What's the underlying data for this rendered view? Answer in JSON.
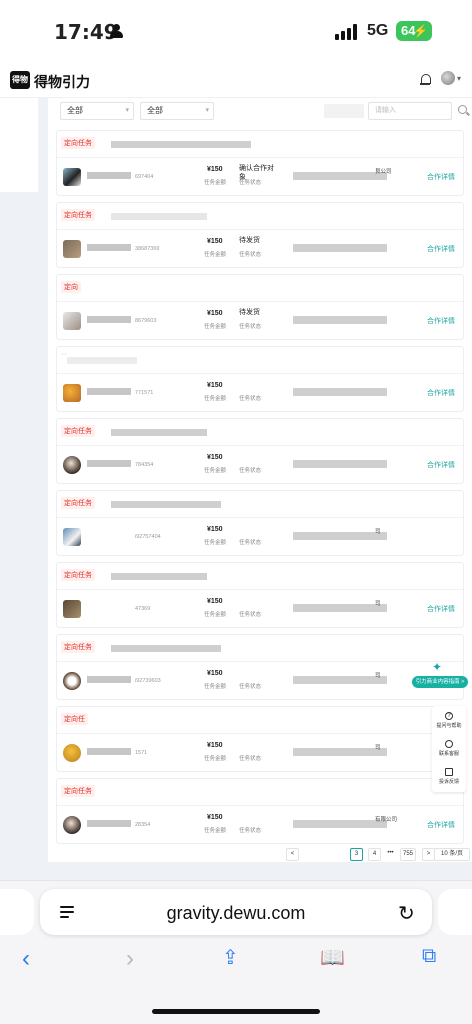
{
  "status_bar": {
    "time": "17:49",
    "network": "5G",
    "battery": "64"
  },
  "header": {
    "logo_mark": "得物",
    "logo_text": "得物引力"
  },
  "filters": {
    "filter1": "全部",
    "filter2": "全部",
    "search_placeholder": "请输入"
  },
  "cards": [
    {
      "tag": "定向任务",
      "code": "697404",
      "amount": "¥150",
      "amount_label": "任务金额",
      "status": "确认合作对象",
      "status_label": "任务状态",
      "company": "艮公司",
      "link": "合作详情"
    },
    {
      "tag": "定向任务",
      "code": "38687369",
      "amount": "¥150",
      "amount_label": "任务金额",
      "status": "待发货",
      "status_label": "任务状态",
      "company": "",
      "link": "合作详情"
    },
    {
      "tag": "定向",
      "code": "8679603",
      "amount": "¥150",
      "amount_label": "任务金额",
      "status": "待发货",
      "status_label": "任务状态",
      "company": "",
      "link": "合作详情"
    },
    {
      "tag": "",
      "code": "771571",
      "amount": "¥150",
      "amount_label": "任务金额",
      "status": "",
      "status_label": "任务状态",
      "company": "",
      "link": "合作详情"
    },
    {
      "tag": "定向任务",
      "code": "784354",
      "amount": "¥150",
      "amount_label": "任务金额",
      "status": "",
      "status_label": "任务状态",
      "company": "",
      "link": "合作详情"
    },
    {
      "tag": "定向任务",
      "code": "i92757404",
      "amount": "¥150",
      "amount_label": "任务金额",
      "status": "",
      "status_label": "任务状态",
      "company": "司",
      "link": ""
    },
    {
      "tag": "定向任务",
      "code": "47369",
      "amount": "¥150",
      "amount_label": "任务金额",
      "status": "",
      "status_label": "任务状态",
      "company": "司",
      "link": "合作详情"
    },
    {
      "tag": "定向任务",
      "code": "i92739603",
      "amount": "¥150",
      "amount_label": "任务金额",
      "status": "",
      "status_label": "任务状态",
      "company": "司",
      "link": ""
    },
    {
      "tag": "定向任",
      "code": "1571",
      "amount": "¥150",
      "amount_label": "任务金额",
      "status": "",
      "status_label": "任务状态",
      "company": "司",
      "link": ""
    },
    {
      "tag": "定向任务",
      "code": "28354",
      "amount": "¥150",
      "amount_label": "任务金额",
      "status": "",
      "status_label": "任务状态",
      "company": "有限公司",
      "link": "合作详情"
    }
  ],
  "float_guide": {
    "label": "引力商业内容指南 >"
  },
  "side_tools": [
    {
      "label": "提问与帮助"
    },
    {
      "label": "联系客服"
    },
    {
      "label": "投诉反馈"
    }
  ],
  "pager": {
    "prev": "<",
    "page3": "3",
    "page4": "4",
    "ellipsis": "•••",
    "last": "755",
    "next": ">",
    "size": "10 条/页"
  },
  "browser": {
    "url": "gravity.dewu.com"
  },
  "colors": {
    "accent": "#19a6a0",
    "tag_red": "#e0312b",
    "battery": "#3bc55a",
    "ios_blue": "#2f7df6"
  }
}
